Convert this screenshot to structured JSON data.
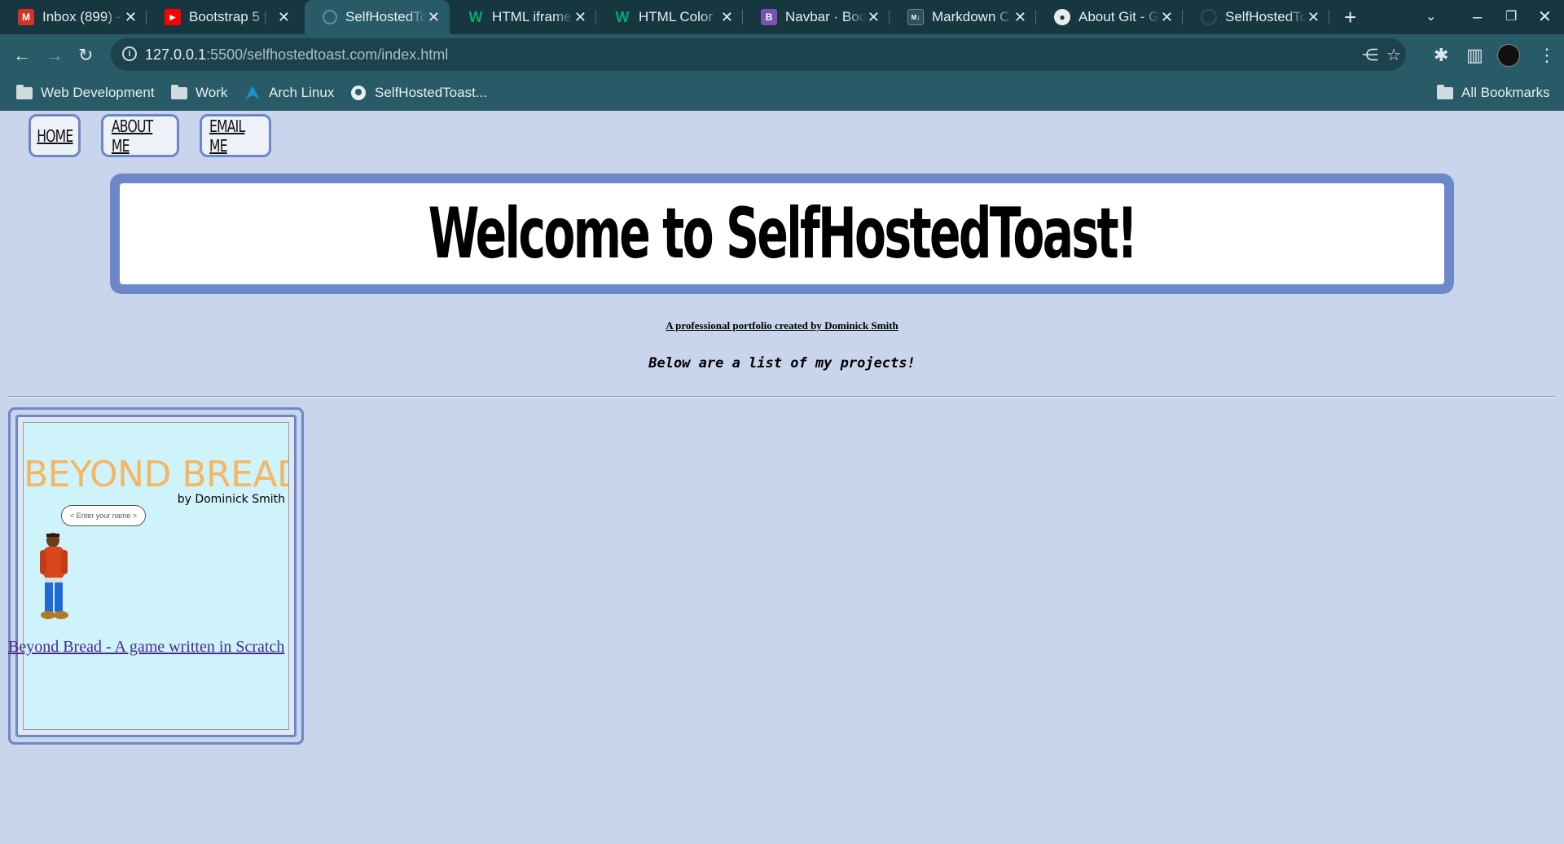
{
  "browser": {
    "tabs": [
      {
        "title": "Inbox (899) -",
        "icon": "gmail-icon",
        "color": "#d93025",
        "glyph": "M"
      },
      {
        "title": "Bootstrap 5 |",
        "icon": "youtube-icon",
        "color": "#ff0000",
        "glyph": "▶"
      },
      {
        "title": "SelfHostedTo",
        "icon": "globe-icon",
        "color": "#3b6572",
        "glyph": "◍"
      },
      {
        "title": "HTML iframe",
        "icon": "w3schools-icon",
        "color": "#04aa6d",
        "glyph": "W"
      },
      {
        "title": "HTML Color",
        "icon": "w3schools-icon",
        "color": "#04aa6d",
        "glyph": "W"
      },
      {
        "title": "Navbar · Boo",
        "icon": "bootstrap-icon",
        "color": "#7952b3",
        "glyph": "B"
      },
      {
        "title": "Markdown C",
        "icon": "markdown-icon",
        "color": "#2e4f58",
        "glyph": "M↓"
      },
      {
        "title": "About Git - G",
        "icon": "github-icon",
        "color": "#16373f",
        "glyph": "◉"
      },
      {
        "title": "SelfHostedTo",
        "icon": "github-icon",
        "color": "#16373f",
        "glyph": "◉"
      }
    ],
    "url_host": "127.0.0.1",
    "url_rest": ":5500/selfhostedtoast.com/index.html",
    "bookmarks": [
      {
        "label": "Web Development",
        "icon": "folder-icon"
      },
      {
        "label": "Work",
        "icon": "folder-icon"
      },
      {
        "label": "Arch Linux",
        "icon": "arch-linux-icon"
      },
      {
        "label": "SelfHostedToast...",
        "icon": "github-icon"
      }
    ],
    "all_bookmarks": "All Bookmarks"
  },
  "nav": {
    "home": "HOME",
    "about": "ABOUT ME",
    "email": "EMAIL ME"
  },
  "header": {
    "title": "Welcome to SelfHostedToast!"
  },
  "subtitle": "A professional portfolio created by Dominick Smith",
  "projects_heading": "Below are a list of my projects!",
  "project": {
    "thumb_title": "BEYOND BREAD",
    "thumb_by": "by Dominick Smith",
    "thumb_bubble": "< Enter your name >",
    "link": "Beyond Bread - A game written in Scratch"
  },
  "colors": {
    "page_bg": "#c8d5ec",
    "accent_border": "#6c88c8",
    "chrome_dark": "#16373f",
    "chrome_mid": "#285a67",
    "link_visited": "#4a2b8c",
    "thumb_title": "#f5b660"
  }
}
